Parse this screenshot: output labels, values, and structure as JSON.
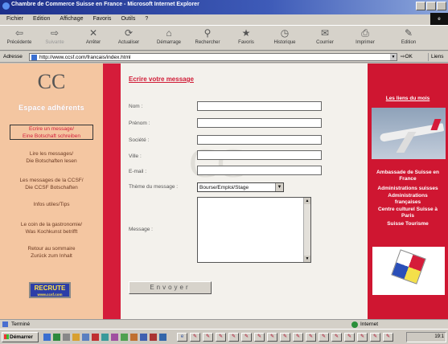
{
  "window": {
    "title": "Chambre de Commerce Suisse en France - Microsoft Internet Explorer",
    "throbber_label": "e"
  },
  "menu": [
    "Fichier",
    "Edition",
    "Affichage",
    "Favoris",
    "Outils",
    "?"
  ],
  "toolbar": [
    {
      "label": "Précédente",
      "icon": "back-arrow-icon",
      "glyph": "⇦"
    },
    {
      "label": "Suivante",
      "icon": "forward-arrow-icon",
      "glyph": "⇨"
    },
    {
      "label": "Arrêter",
      "icon": "stop-icon",
      "glyph": "✕"
    },
    {
      "label": "Actualiser",
      "icon": "refresh-icon",
      "glyph": "⟳"
    },
    {
      "label": "Démarrage",
      "icon": "home-icon",
      "glyph": "⌂"
    },
    {
      "label": "Rechercher",
      "icon": "search-icon",
      "glyph": "⚲"
    },
    {
      "label": "Favoris",
      "icon": "favorites-icon",
      "glyph": "★"
    },
    {
      "label": "Historique",
      "icon": "history-icon",
      "glyph": "◷"
    },
    {
      "label": "Courrier",
      "icon": "mail-icon",
      "glyph": "✉"
    },
    {
      "label": "Imprimer",
      "icon": "print-icon",
      "glyph": "⎙"
    },
    {
      "label": "Edition",
      "icon": "edit-icon",
      "glyph": "✎"
    }
  ],
  "address": {
    "label": "Adresse",
    "url": "http://www.ccsf.com/francais/index.html",
    "go_label": "OK",
    "links_label": "Liens"
  },
  "leftnav": {
    "logo": "CC",
    "heading": "Espace adhérents",
    "links": [
      "Ecrire un message/\nEine Botschaft schreiben",
      "Lire les messages/\nDie Botschaften lesen",
      "Les messages de la CCSF/\nDie CCSF Botschaften",
      "Infos utiles/Tips",
      "Le coin de la gastronomie/\nWas Kochkunst betrifft",
      "Retour au sommaire\nZurück zum Inhalt"
    ],
    "recrute": "RECRUTE",
    "recrute_url": "www.ccsf.com"
  },
  "form": {
    "title": "Ecrire votre message",
    "watermark": "CC",
    "labels": {
      "nom": "Nom :",
      "prenom": "Prénom :",
      "societe": "Société :",
      "ville": "Ville :",
      "email": "E-mail :",
      "theme": "Thème du message :",
      "message": "Message :"
    },
    "values": {
      "nom": "",
      "prenom": "",
      "societe": "",
      "ville": "",
      "email": "",
      "message": ""
    },
    "theme_selected": "Bourse/Emploi/Stage",
    "submit": "Envoyer"
  },
  "rightcol": {
    "heading": "Les liens du mois",
    "links": [
      "Ambassade de Suisse en\nFrance",
      "Administrations suisses",
      "Administrations\nfrançaises",
      "Centre culturel Suisse à\nParis",
      "Suisse Tourisme"
    ]
  },
  "status": {
    "text": "Terminé",
    "zone": "Internet"
  },
  "taskbar": {
    "start": "Démarrer",
    "clock": "19:1"
  }
}
